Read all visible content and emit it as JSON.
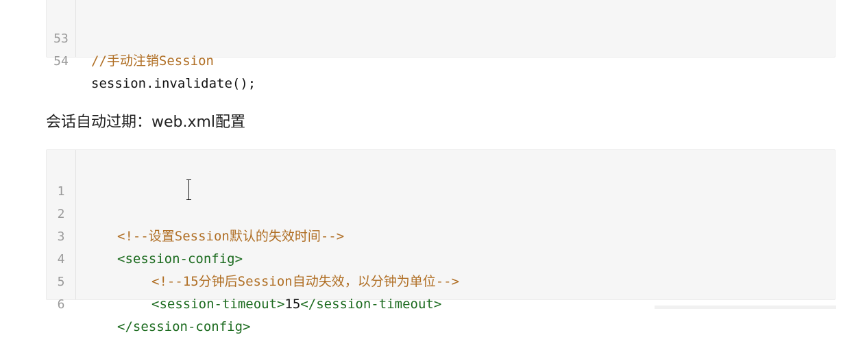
{
  "block1": {
    "lines": [
      {
        "num": "53",
        "text": "//手动注销Session"
      },
      {
        "num": "54",
        "text": "session.invalidate();"
      }
    ]
  },
  "heading": "会话自动过期：web.xml配置",
  "block2": {
    "lines": [
      {
        "num": "1",
        "text": ""
      },
      {
        "num": "2",
        "text": "<!--设置Session默认的失效时间-->"
      },
      {
        "num": "3",
        "text": "<session-config>"
      },
      {
        "num": "4",
        "text": "<!--15分钟后Session自动失效，以分钟为单位-->"
      },
      {
        "num": "5",
        "open_tag": "<session-timeout>",
        "value": "15",
        "close_tag": "</session-timeout>"
      },
      {
        "num": "6",
        "text": "</session-config>"
      }
    ]
  },
  "colors": {
    "comment": "#b06f25",
    "tag": "#1c6b1f",
    "text": "#111111",
    "line_number": "#9a9a9a",
    "code_background": "#f6f6f6"
  }
}
